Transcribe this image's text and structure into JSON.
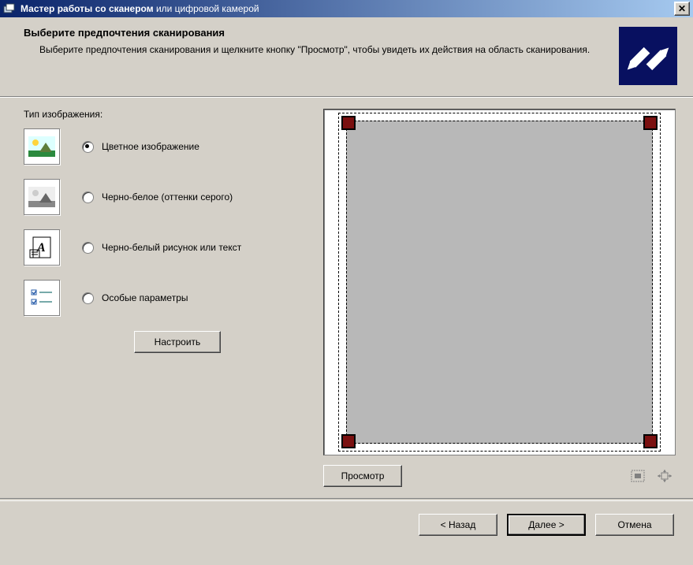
{
  "window": {
    "title_bold": "Мастер работы со сканером",
    "title_rest": " или цифровой камерой"
  },
  "header": {
    "title": "Выберите предпочтения сканирования",
    "description": "Выберите предпочтения сканирования и щелкните кнопку \"Просмотр\", чтобы увидеть их действия на область сканирования."
  },
  "options": {
    "group_label": "Тип изображения:",
    "items": [
      {
        "id": "color",
        "label": "Цветное изображение",
        "checked": true
      },
      {
        "id": "grayscale",
        "label": "Черно-белое (оттенки серого)",
        "checked": false
      },
      {
        "id": "bw",
        "label": "Черно-белый рисунок или текст",
        "checked": false
      },
      {
        "id": "custom",
        "label": "Особые параметры",
        "checked": false
      }
    ],
    "configure_button": "Настроить"
  },
  "preview": {
    "preview_button": "Просмотр"
  },
  "footer": {
    "back": "< Назад",
    "next": "Далее >",
    "cancel": "Отмена"
  }
}
